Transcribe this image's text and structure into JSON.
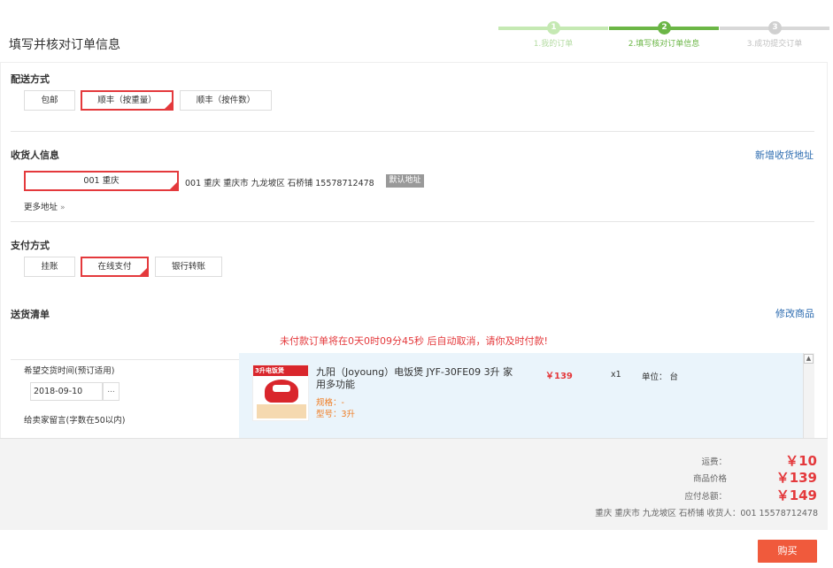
{
  "page": {
    "title": "填写并核对订单信息"
  },
  "steps": [
    {
      "num": "1",
      "label": "1.我的订单"
    },
    {
      "num": "2",
      "label": "2.填写核对订单信息"
    },
    {
      "num": "3",
      "label": "3.成功提交订单"
    }
  ],
  "delivery": {
    "title": "配送方式",
    "options": [
      "包邮",
      "顺丰（按重量）",
      "顺丰（按件数）"
    ],
    "selected": "顺丰（按重量）"
  },
  "receiver": {
    "title": "收货人信息",
    "add_link": "新增收货地址",
    "selected_name": "001 重庆",
    "address": "001   重庆 重庆市 九龙坡区 石桥铺   15578712478",
    "default_badge": "默认地址",
    "more": "更多地址",
    "more_icon": "chevron-double-down-icon"
  },
  "payment": {
    "title": "支付方式",
    "options": [
      "挂账",
      "在线支付",
      "银行转账"
    ],
    "selected": "在线支付"
  },
  "items": {
    "title": "送货清单",
    "edit_link": "修改商品",
    "countdown": "未付款订单将在0天0时09分45秒 后自动取消，请你及时付款!",
    "delivery_time_label": "希望交货时间(预订适用)",
    "delivery_date": "2018-09-10",
    "date_button": "...",
    "message_label": "给卖家留言(字数在50以内)",
    "product": {
      "image_text": "3升电饭煲",
      "name": "九阳（Joyoung）电饭煲 JYF-30FE09 3升 家用多功能",
      "spec": "规格：-",
      "model": "型号：3升",
      "price": "￥139",
      "qty": "x1",
      "unit": "单位：  台"
    }
  },
  "summary": {
    "freight_label": "运费：",
    "freight": "￥10",
    "goods_label": "商品价格",
    "goods": "￥139",
    "total_label": "应付总额：",
    "total": "￥149",
    "address_line": "重庆 重庆市 九龙坡区 石桥铺      收货人：001 15578712478"
  },
  "buy_button": "购买",
  "colors": {
    "accent": "#e4393c",
    "step_active": "#6bb646",
    "link": "#2d6cb0",
    "buy": "#f05a3c"
  }
}
